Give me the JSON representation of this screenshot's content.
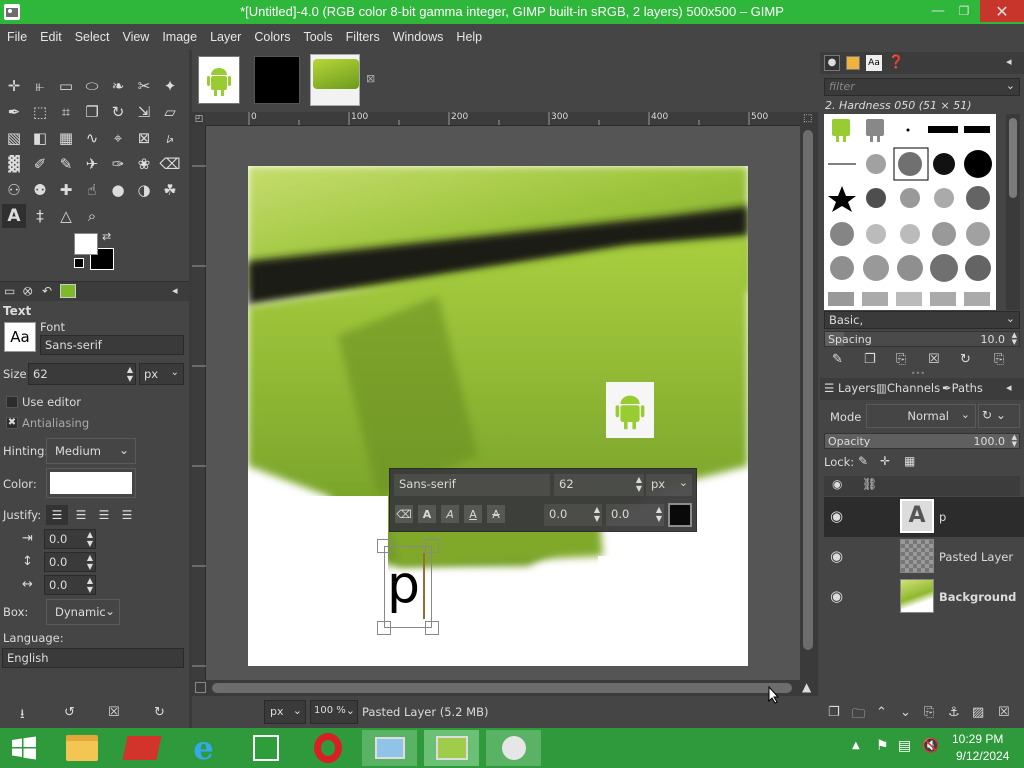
{
  "window": {
    "title": "*[Untitled]-4.0 (RGB color 8-bit gamma integer, GIMP built-in sRGB, 2 layers) 500x500 – GIMP"
  },
  "menu": [
    "File",
    "Edit",
    "Select",
    "View",
    "Image",
    "Layer",
    "Colors",
    "Tools",
    "Filters",
    "Windows",
    "Help"
  ],
  "tool_options": {
    "title": "Text",
    "font_label": "Font",
    "font_value": "Sans-serif",
    "font_icon_text": "Aa",
    "size_label": "Size:",
    "size_value": "62",
    "size_unit": "px",
    "use_editor": "Use editor",
    "antialiasing": "Antialiasing",
    "hinting_label": "Hinting:",
    "hinting_value": "Medium",
    "color_label": "Color:",
    "justify_label": "Justify:",
    "indent": "0.0",
    "line_spacing": "0.0",
    "letter_spacing": "0.0",
    "box_label": "Box:",
    "box_value": "Dynamic",
    "language_label": "Language:",
    "language_value": "English"
  },
  "canvas": {
    "ruler_h": [
      "0",
      "100",
      "200",
      "300",
      "400",
      "500"
    ],
    "text_toolbox": {
      "font": "Sans-serif",
      "size": "62",
      "unit": "px",
      "baseline": "0.0",
      "kerning": "0.0"
    },
    "text_layer_content": "p",
    "status": {
      "unit": "px",
      "zoom": "100 %",
      "message": "Pasted Layer (5.2 MB)"
    }
  },
  "brushes": {
    "filter_placeholder": "filter",
    "current": "2. Hardness 050 (51 × 51)",
    "tag": "Basic,",
    "spacing_label": "Spacing",
    "spacing_value": "10.0"
  },
  "layers": {
    "tabs": [
      "Layers",
      "Channels",
      "Paths"
    ],
    "mode_label": "Mode",
    "mode_value": "Normal",
    "opacity_label": "Opacity",
    "opacity_value": "100.0",
    "lock_label": "Lock:",
    "items": [
      {
        "name": "p",
        "bold": false
      },
      {
        "name": "Pasted Layer",
        "bold": false
      },
      {
        "name": "Background",
        "bold": true
      }
    ]
  },
  "taskbar": {
    "time": "10:29 PM",
    "date": "9/12/2024"
  }
}
